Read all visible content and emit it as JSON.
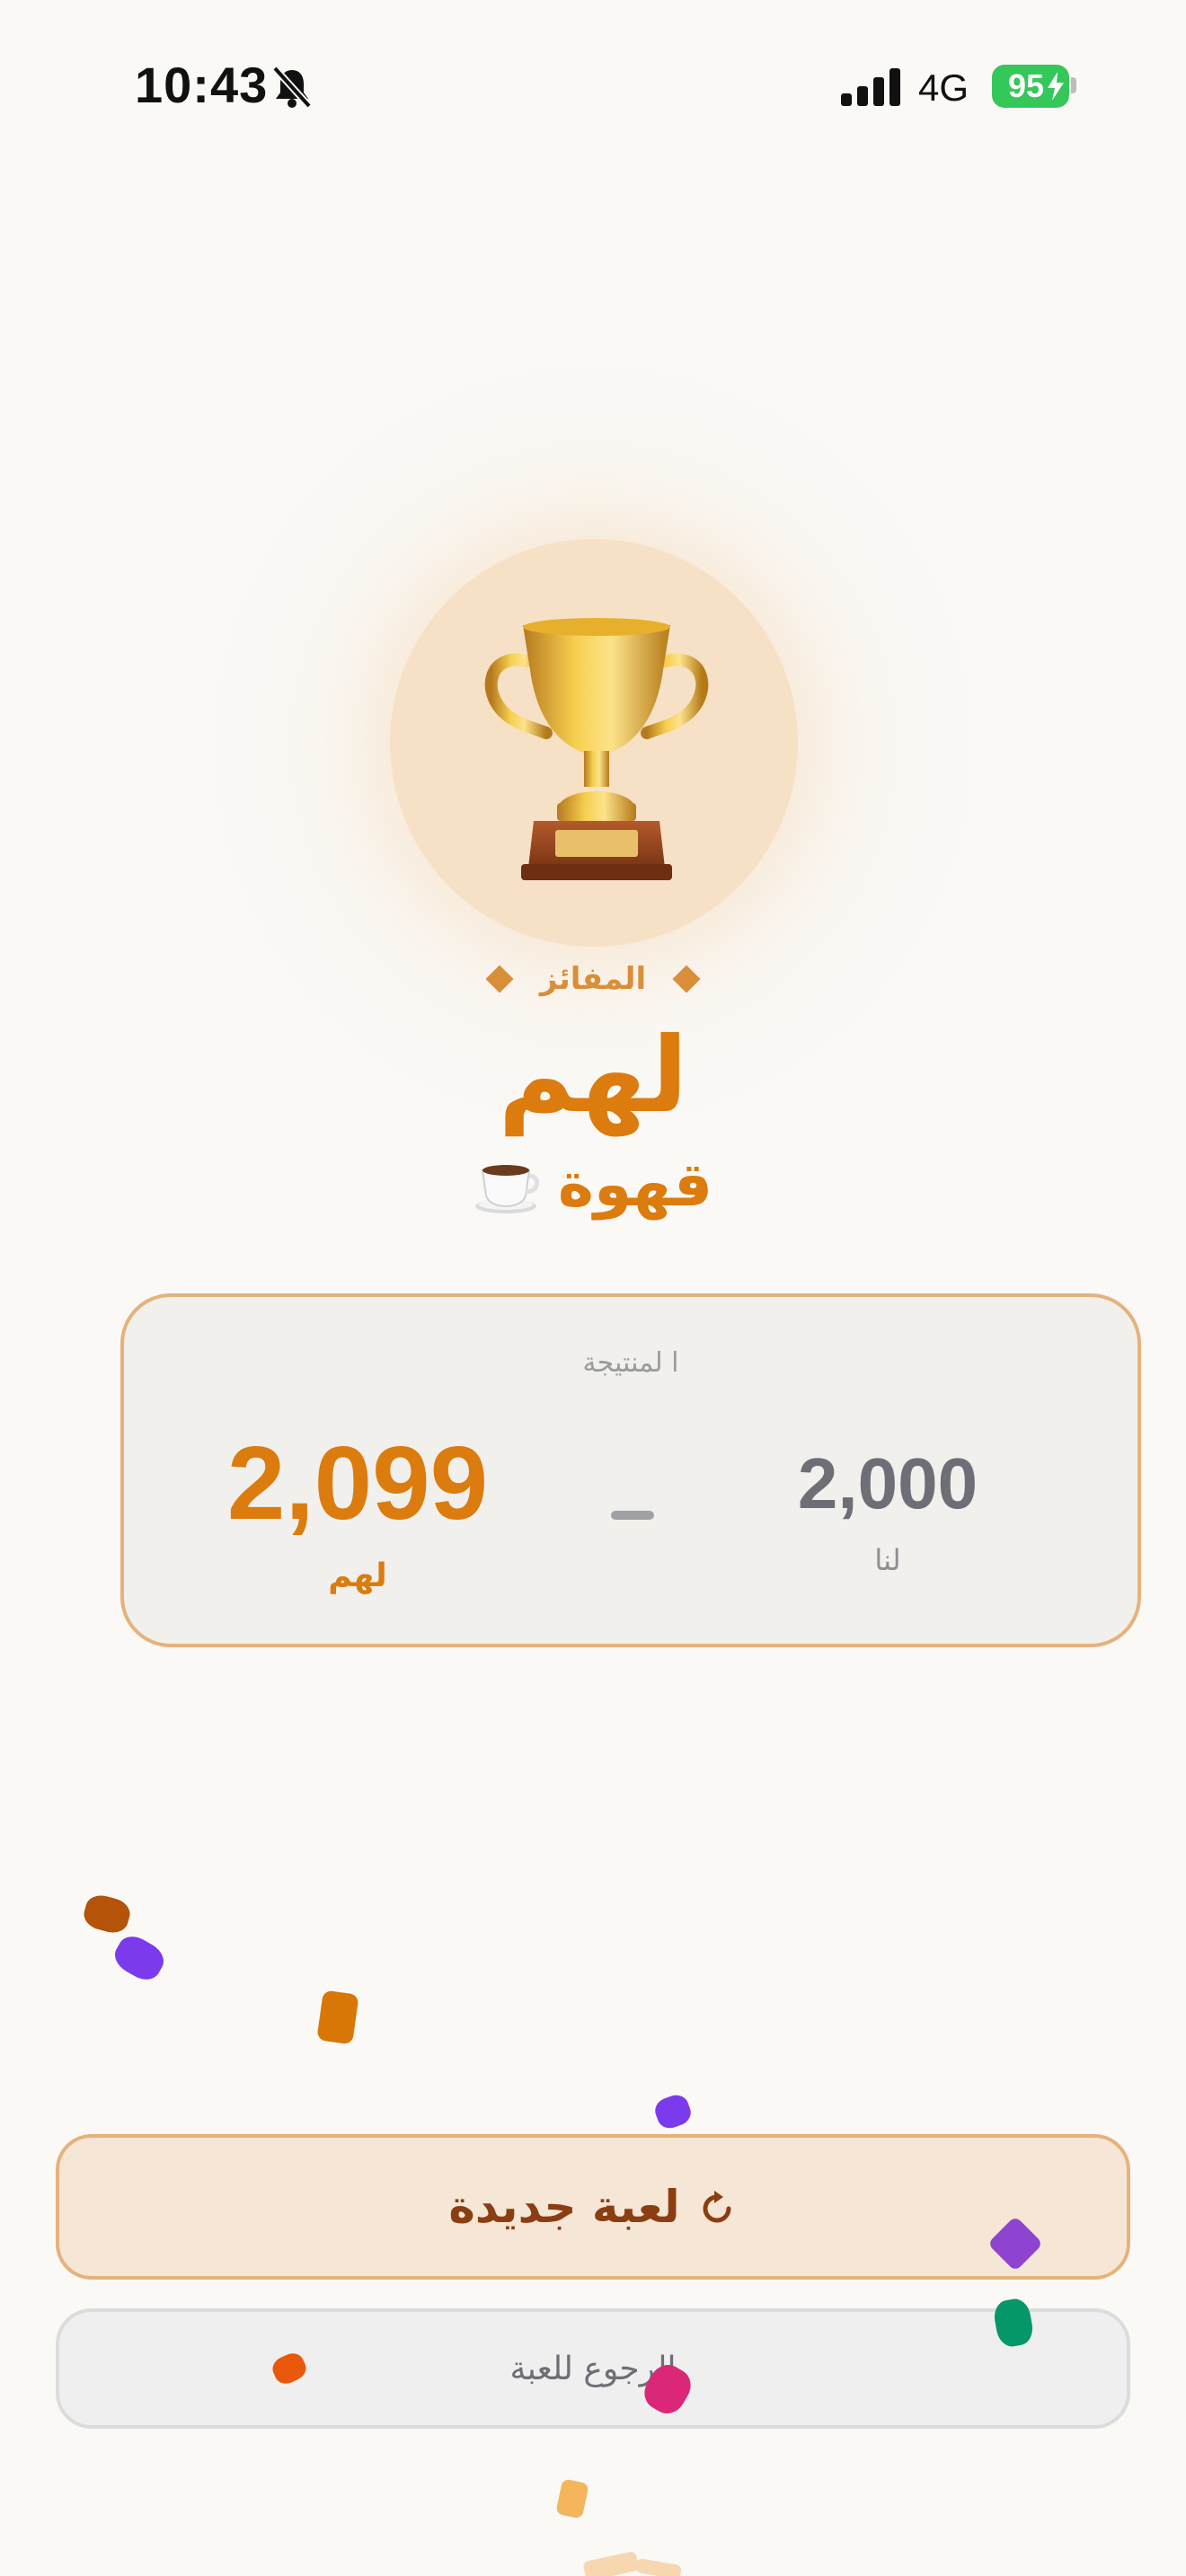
{
  "status_bar": {
    "time": "10:43",
    "network": "4G",
    "battery": "95",
    "icons": [
      "bell-slash-icon",
      "signal-icon",
      "battery-charging-icon"
    ]
  },
  "result": {
    "winner_label": "المفائز",
    "winner_name": "لهم",
    "prize": "قهوة",
    "prize_icon": "coffee-cup-icon",
    "trophy_icon": "trophy-icon"
  },
  "score": {
    "title": "ا  لمنتيجة",
    "them_value": "2,099",
    "them_label": "لهم",
    "us_value": "2,000",
    "us_label": "لنا"
  },
  "actions": {
    "new_game_label": "لعبة جديدة",
    "new_game_icon": "refresh-icon",
    "back_label": "الرجوع للعبة"
  },
  "colors": {
    "accent": "#DC7B0E",
    "accent_light": "#F6E1C7",
    "card_border": "#E6B27C",
    "background": "#FAF9F6",
    "muted_text": "#8E8E93"
  }
}
